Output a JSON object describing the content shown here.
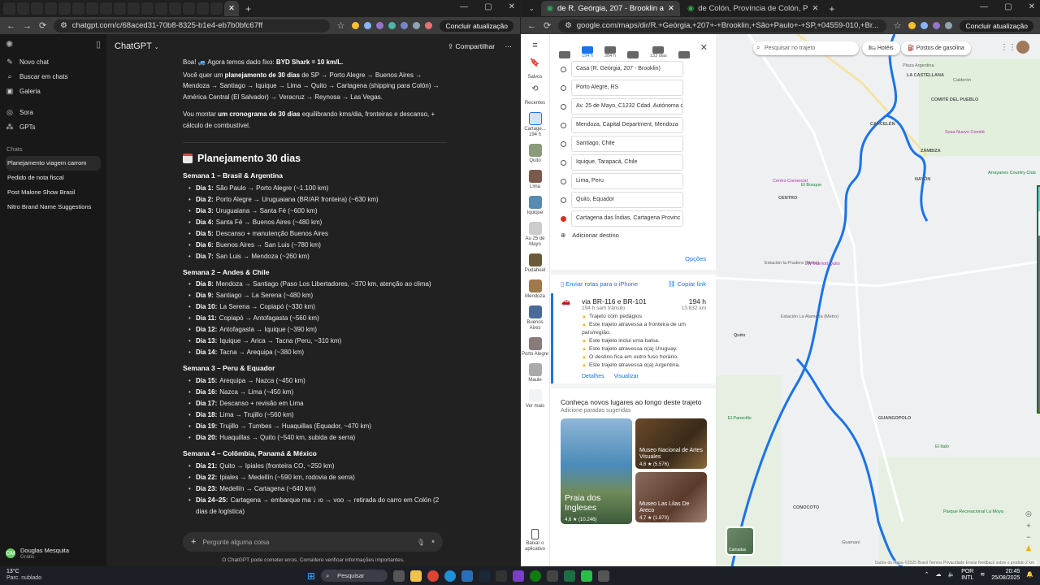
{
  "left_window": {
    "tabs": [
      {
        "label": "",
        "color": "#e53935"
      },
      {
        "label": "",
        "color": "#2196f3"
      },
      {
        "label": "",
        "color": "#4caf50"
      },
      {
        "label": "",
        "color": "#ffffff"
      },
      {
        "label": "",
        "color": "#ffffff"
      },
      {
        "label": "",
        "color": "#e53935"
      },
      {
        "label": "",
        "color": "#9e9e9e"
      },
      {
        "label": "",
        "color": "#ffffff"
      },
      {
        "label": "",
        "color": "#e53935"
      },
      {
        "label": "",
        "color": "#ffffff"
      },
      {
        "label": "",
        "color": "#4caf50"
      },
      {
        "label": "",
        "color": "#ffffff"
      },
      {
        "label": "",
        "color": "#9e9e9e"
      },
      {
        "label": "",
        "color": "#e53935"
      },
      {
        "label": "",
        "color": "#e53935"
      },
      {
        "label": "",
        "color": "#e53935"
      }
    ],
    "url": "chatgpt.com/c/68aced31-70b8-8325-b1e4-eb7b0bfc67ff",
    "update_label": "Concluir atualização"
  },
  "chatgpt": {
    "title": "ChatGPT",
    "share_label": "Compartilhar",
    "nav": [
      {
        "icon": "pencil-icon",
        "glyph": "✎",
        "label": "Novo chat"
      },
      {
        "icon": "search-icon",
        "glyph": "⌕",
        "label": "Buscar em chats"
      },
      {
        "icon": "gallery-icon",
        "glyph": "▣",
        "label": "Galeria"
      },
      {
        "icon": "sora-icon",
        "glyph": "◎",
        "label": "Sora"
      },
      {
        "icon": "gpts-icon",
        "glyph": "⁂",
        "label": "GPTs"
      }
    ],
    "chats_heading": "Chats",
    "chats": [
      "Planejamento viagem carrom",
      "Pedido de nota fiscal",
      "Post Malone Show Brasil",
      "Nitro Brand Name Suggestions"
    ],
    "user": {
      "initials": "DM",
      "name": "Douglas Mesquita",
      "plan": "Grátis"
    },
    "intro1_a": "Boa! 🚙 Agora temos dado fixo: ",
    "intro1_b": "BYD Shark = 10 km/L.",
    "intro2_a": "Você quer um ",
    "intro2_b": "planejamento de 30 dias",
    "intro2_c": " de SP → Porto Alegre → Buenos Aires → Mendoza → Santiago → Iquique → Lima → Quito → Cartagena (shipping para Colón) → América Central (El Salvador) → Veracruz → Reynosa → Las Vegas.",
    "intro3_a": "Vou montar ",
    "intro3_b": "um cronograma de 30 dias",
    "intro3_c": " equilibrando kms/dia, fronteiras e descanso, + cálculo de combustível.",
    "plan_title": "Planejamento 30 dias",
    "weeks": [
      {
        "title": "Semana 1 – Brasil & Argentina",
        "days": [
          {
            "d": "Dia 1:",
            "t": "São Paulo → Porto Alegre (~1.100 km)"
          },
          {
            "d": "Dia 2:",
            "t": "Porto Alegre → Uruguaiana (BR/AR fronteira) (~630 km)"
          },
          {
            "d": "Dia 3:",
            "t": "Uruguaiana → Santa Fé (~600 km)"
          },
          {
            "d": "Dia 4:",
            "t": "Santa Fé → Buenos Aires (~480 km)"
          },
          {
            "d": "Dia 5:",
            "t": "Descanso + manutenção Buenos Aires"
          },
          {
            "d": "Dia 6:",
            "t": "Buenos Aires → San Luis (~780 km)"
          },
          {
            "d": "Dia 7:",
            "t": "San Luis → Mendoza (~260 km)"
          }
        ]
      },
      {
        "title": "Semana 2 – Andes & Chile",
        "days": [
          {
            "d": "Dia 8:",
            "t": "Mendoza → Santiago (Paso Los Libertadores, ~370 km, atenção ao clima)"
          },
          {
            "d": "Dia 9:",
            "t": "Santiago → La Serena (~480 km)"
          },
          {
            "d": "Dia 10:",
            "t": "La Serena → Copiapó (~330 km)"
          },
          {
            "d": "Dia 11:",
            "t": "Copiapó → Antofagasta (~560 km)"
          },
          {
            "d": "Dia 12:",
            "t": "Antofagasta → Iquique (~390 km)"
          },
          {
            "d": "Dia 13:",
            "t": "Iquique → Arica → Tacna (Peru, ~310 km)"
          },
          {
            "d": "Dia 14:",
            "t": "Tacna → Arequipa (~380 km)"
          }
        ]
      },
      {
        "title": "Semana 3 – Peru & Equador",
        "days": [
          {
            "d": "Dia 15:",
            "t": "Arequipa → Nazca (~450 km)"
          },
          {
            "d": "Dia 16:",
            "t": "Nazca → Lima (~450 km)"
          },
          {
            "d": "Dia 17:",
            "t": "Descanso + revisão em Lima"
          },
          {
            "d": "Dia 18:",
            "t": "Lima → Trujillo (~560 km)"
          },
          {
            "d": "Dia 19:",
            "t": "Trujillo → Tumbes → Huaquillas (Equador, ~470 km)"
          },
          {
            "d": "Dia 20:",
            "t": "Huaquillas → Quito (~540 km, subida de serra)"
          }
        ]
      },
      {
        "title": "Semana 4 – Colômbia, Panamá & México",
        "days": [
          {
            "d": "Dia 21:",
            "t": "Quito → Ipiales (fronteira CO, ~250 km)"
          },
          {
            "d": "Dia 22:",
            "t": "Ipiales → Medellín (~590 km, rodovia de serra)"
          },
          {
            "d": "Dia 23:",
            "t": "Medellín → Cartagena (~640 km)"
          },
          {
            "d": "Dia 24–25:",
            "t": "Cartagena → embarque ma ↓ ıo → voo → retirada do carro em Colón (2"
          },
          {
            "d": "",
            "t": "dias de logística)"
          }
        ]
      }
    ],
    "composer_placeholder": "Pergunte alguma coisa",
    "disclaimer": "O ChatGPT pode cometer erros. Considere verificar informações importantes."
  },
  "right_window": {
    "tabs": [
      {
        "label": "de R. Geórgia, 207 - Brooklin a"
      },
      {
        "label": "de Colón, Província de Colón, P"
      }
    ],
    "url": "google.com/maps/dir/R.+Geórgia,+207+-+Brooklin,+São+Paulo+-+SP,+04559-010,+Br...",
    "update_label": "Concluir atualização"
  },
  "maps": {
    "rail": [
      {
        "label": "Salvos",
        "icon": "bookmark-icon",
        "color": "#ffffff"
      },
      {
        "label": "Recentes",
        "icon": "history-icon",
        "color": "#ffffff"
      },
      {
        "label": "Cartage... 194 h",
        "icon": "route-icon",
        "color": "#d2e3fc"
      },
      {
        "label": "Quito",
        "icon": "place-thumb-icon",
        "color": "#8a9a7a"
      },
      {
        "label": "Lima",
        "icon": "place-thumb-icon",
        "color": "#7a5a4a"
      },
      {
        "label": "Iquique",
        "icon": "place-thumb-icon",
        "color": "#5a8ab0"
      },
      {
        "label": "Au 25 de Mayo",
        "icon": "place-thumb-icon",
        "color": "#cccccc"
      },
      {
        "label": "Pudahuel",
        "icon": "place-thumb-icon",
        "color": "#6a5a3a"
      },
      {
        "label": "Mendoza",
        "icon": "place-thumb-icon",
        "color": "#a07a4a"
      },
      {
        "label": "Buenos Aires",
        "icon": "place-thumb-icon",
        "color": "#4a6a9a"
      },
      {
        "label": "Porto Alegre",
        "icon": "place-thumb-icon",
        "color": "#8a7a7a"
      },
      {
        "label": "Maule",
        "icon": "place-thumb-icon",
        "color": "#aaaaaa"
      },
      {
        "label": "Ver mais",
        "icon": "more-icon",
        "color": "#f1f3f4"
      }
    ],
    "download_label": "Baixar o aplicativo",
    "modes": [
      {
        "label": ""
      },
      {
        "label": "194 h"
      },
      {
        "label": "284 h"
      },
      {
        "label": ""
      },
      {
        "label": "133 dias"
      },
      {
        "label": ""
      }
    ],
    "stops": [
      "Casa (R. Geórgia, 207 - Brooklin)",
      "Porto Alegre, RS",
      "Av. 25 de Mayo, C1232 Cdad. Autónoma d",
      "Mendoza, Capital Department, Mendoza",
      "Santiago, Chile",
      "Iquique, Tarapacá, Chile",
      "Lima, Peru",
      "Quito, Equador",
      "Cartagena das Índias, Cartagena Provinc"
    ],
    "add_destination": "Adicionar destino",
    "options": "Opções",
    "send_iphone": "Enviar rotas para o iPhone",
    "copy_link": "Copiar link",
    "route": {
      "via": "via BR-116 e BR-101",
      "time": "194 h",
      "traffic": "194 h sem trânsito",
      "distance": "13.832 km",
      "warnings": [
        "Trajeto com pedágios",
        "Este trajeto atravessa a fronteira de um país/região.",
        "Este trajeto inclui uma balsa.",
        "Este trajeto atravessa o(a) Uruguay.",
        "O destino fica em outro fuso horário.",
        "Este trajeto atravessa o(a) Argentina."
      ],
      "details": "Detalhes",
      "view": "Visualizar"
    },
    "discover_title": "Conheça novos lugares ao longo deste trajeto",
    "discover_sub": "Adicione paradas sugeridas",
    "cards": [
      {
        "name": "Praia dos Ingleses",
        "rating": "4,6 ★ (10.246)"
      },
      {
        "name": "Museo Nacional de Artes Visuales",
        "rating": "4,6 ★ (5.576)"
      },
      {
        "name": "Museo Las Lilas De Areco",
        "rating": "4,7 ★ (1.870)"
      }
    ],
    "search_placeholder": "Pesquisar no trajeto",
    "chips": [
      "Hotéis",
      "Postos de gasolina"
    ],
    "labels": [
      {
        "t": "LA CASTELLANA",
        "c": "b"
      },
      {
        "t": "Plaza Argentina",
        "c": ""
      },
      {
        "t": "Calderón",
        "c": ""
      },
      {
        "t": "COMITÉ DEL PUEBLO",
        "c": "b"
      },
      {
        "t": "CARCELÉN",
        "c": "b"
      },
      {
        "t": "Sosa Nuevo Comité",
        "c": "p"
      },
      {
        "t": "ZÁMBIZA",
        "c": "b"
      },
      {
        "t": "NAYÓN",
        "c": "b"
      },
      {
        "t": "Arrayanes Country Club",
        "c": "g"
      },
      {
        "t": "El Bosque",
        "c": "g"
      },
      {
        "t": "Centro Comercial",
        "c": "p"
      },
      {
        "t": "CENTRO",
        "c": "b"
      },
      {
        "t": "Estación la Pradera (Metro)",
        "c": ""
      },
      {
        "t": "JW Marriott Quito",
        "c": "p"
      },
      {
        "t": "Estación La Alameda (Metro)",
        "c": ""
      },
      {
        "t": "Quito",
        "c": "b"
      },
      {
        "t": "El Panecillo",
        "c": "g"
      },
      {
        "t": "GUANGOPOLO",
        "c": "b"
      },
      {
        "t": "El Italo",
        "c": "g"
      },
      {
        "t": "Parque Recreacional La Moya",
        "c": "g"
      },
      {
        "t": "CONOCOTO",
        "c": "b"
      },
      {
        "t": "Guamaní",
        "c": ""
      }
    ],
    "camadas": "Camadas",
    "footer": "Dados do mapa ©2025   Brasil   Termos   Privacidade   Enviar feedback sobre o produto   2 km"
  },
  "taskbar": {
    "weather_temp": "13°C",
    "weather_text": "Parc. nublado",
    "search": "Pesquisar",
    "lang": "POR",
    "lang2": "INTL",
    "time": "20:45",
    "date": "25/08/2025"
  }
}
